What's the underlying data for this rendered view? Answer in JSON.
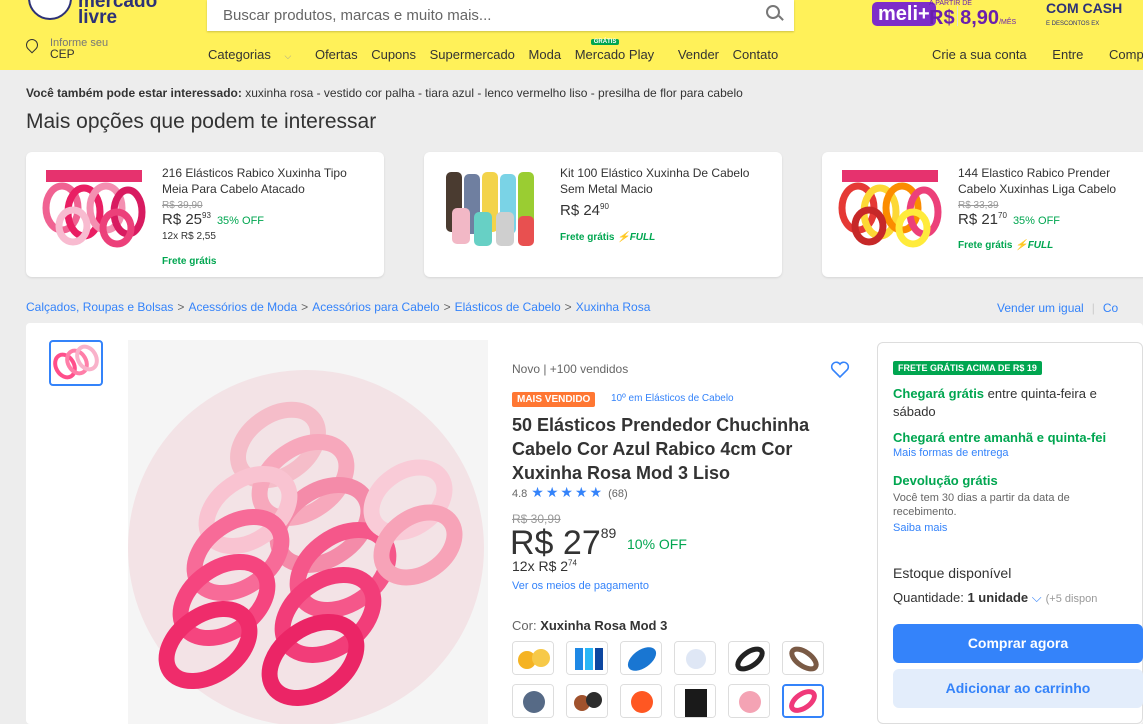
{
  "header": {
    "logo_text": "mercado livre",
    "search_placeholder": "Buscar produtos, marcas e muito mais...",
    "meli_plus": "meli+",
    "meli_small": "A PARTIR DE",
    "meli_price": "R$ 8,90",
    "meli_per": "/MÊS",
    "cash_title": "COM CASH",
    "cash_sub": "E DESCONTOS EX",
    "cep_line1": "Informe seu",
    "cep_line2": "CEP",
    "nav": [
      "Categorias",
      "Ofertas",
      "Cupons",
      "Supermercado",
      "Moda",
      "Mercado Play",
      "Vender",
      "Contato"
    ],
    "nav_badge": "GRÁTIS",
    "account": [
      "Crie a sua conta",
      "Entre",
      "Comp"
    ]
  },
  "also_interested": {
    "label": "Você também pode estar interessado:",
    "terms": "xuxinha rosa - vestido cor palha - tiara azul - lenco vermelho liso - presilha de flor para cabelo"
  },
  "more_options_title": "Mais opções que podem te interessar",
  "cards": [
    {
      "title": "216 Elásticos Rabico Xuxinha Tipo Meia Para Cabelo Atacado",
      "old": "R$ 39,90",
      "price": "R$ 25",
      "cents": "93",
      "off": "35% OFF",
      "inst": "12x R$ 2,55",
      "frete": "Frete grátis",
      "full": ""
    },
    {
      "title": "Kit 100 Elástico Xuxinha De Cabelo Sem Metal Macio",
      "old": "",
      "price": "R$ 24",
      "cents": "90",
      "off": "",
      "inst": "",
      "frete": "Frete grátis",
      "full": "⚡FULL"
    },
    {
      "title": "144 Elastico Rabico Prender Cabelo Xuxinhas Liga Cabelo",
      "old": "R$ 33,39",
      "price": "R$ 21",
      "cents": "70",
      "off": "35% OFF",
      "inst": "",
      "frete": "Frete grátis",
      "full": "⚡FULL"
    }
  ],
  "breadcrumbs": [
    "Calçados, Roupas e Bolsas",
    "Acessórios de Moda",
    "Acessórios para Cabelo",
    "Elásticos de Cabelo",
    "Xuxinha Rosa"
  ],
  "vend_links": [
    "Vender um igual",
    "Co"
  ],
  "product": {
    "condition": "Novo  |  +100 vendidos",
    "badge": "MAIS VENDIDO",
    "badge_link": "10º em Elásticos de Cabelo",
    "title": "50 Elásticos Prendedor Chuchinha Cabelo Cor Azul Rabico 4cm Cor Xuxinha Rosa Mod 3 Liso",
    "rating": "4.8",
    "stars": "★★★★★",
    "reviews": "(68)",
    "old_price": "R$ 30,99",
    "price": "R$ 27",
    "price_cents": "89",
    "off": "10% OFF",
    "installments": "12x R$ 2",
    "inst_cents": "74",
    "payment_link": "Ver os meios de pagamento",
    "color_label": "Cor:",
    "color_value": "Xuxinha Rosa Mod 3"
  },
  "shipping": {
    "badge": "FRETE GRÁTIS ACIMA DE R$ 19",
    "arrive1_bold": "Chegará grátis",
    "arrive1_rest": "entre quinta-feira e sábado",
    "arrive2": "Chegará entre amanhã e quinta-fei",
    "more_forms": "Mais formas de entrega",
    "return_title": "Devolução grátis",
    "return_text": "Você tem 30 dias a partir da data de recebimento.",
    "learn_more": "Saiba mais",
    "stock": "Estoque disponível",
    "qty_label": "Quantidade:",
    "qty_value": "1 unidade",
    "qty_avail": "(+5 dispon",
    "buy": "Comprar agora",
    "cart": "Adicionar ao carrinho"
  },
  "colors": {
    "brand_yellow": "#fff159",
    "blue": "#3483fa",
    "green": "#00a650",
    "orange": "#ff7733",
    "meli_purple": "#7d2dc9"
  }
}
